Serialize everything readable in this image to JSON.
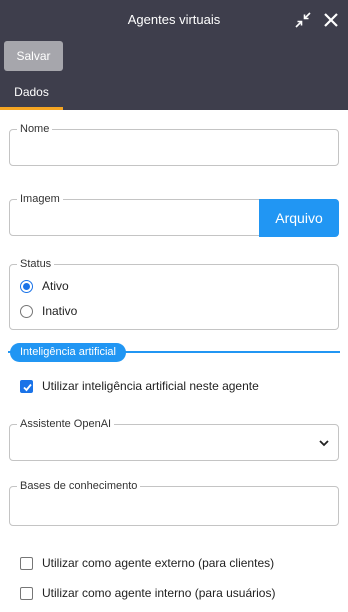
{
  "window": {
    "title": "Agentes virtuais"
  },
  "toolbar": {
    "save_label": "Salvar"
  },
  "tabs": [
    {
      "label": "Dados",
      "active": true
    }
  ],
  "form": {
    "nome": {
      "label": "Nome",
      "value": ""
    },
    "imagem": {
      "label": "Imagem",
      "value": "",
      "button_label": "Arquivo"
    },
    "status": {
      "label": "Status",
      "options": [
        {
          "label": "Ativo",
          "checked": true
        },
        {
          "label": "Inativo",
          "checked": false
        }
      ]
    },
    "ai_section": {
      "title": "Inteligência artificial",
      "use_ai": {
        "label": "Utilizar inteligência artificial neste agente",
        "checked": true
      },
      "assistente": {
        "label": "Assistente OpenAI",
        "value": ""
      },
      "bases": {
        "label": "Bases de conhecimento",
        "value": ""
      }
    },
    "externo": {
      "label": "Utilizar como agente externo (para clientes)",
      "checked": false
    },
    "interno": {
      "label": "Utilizar como agente interno (para usuários)",
      "checked": false
    }
  },
  "colors": {
    "header_bg": "#3e3e4c",
    "accent": "#2196f3",
    "tab_underline": "#f5a623"
  },
  "icons": {
    "shrink": "shrink-icon",
    "close": "close-icon",
    "chevron": "chevron-down-icon"
  }
}
